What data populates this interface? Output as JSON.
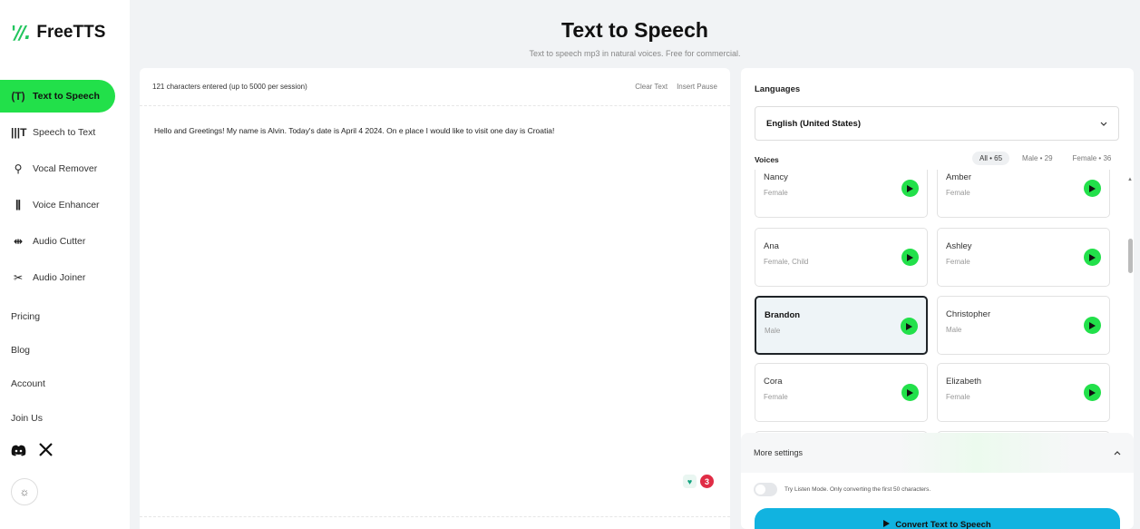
{
  "app": {
    "logo_mark": "'//.",
    "logo_text": "FreeTTS"
  },
  "sidebar": {
    "items": [
      {
        "label": "Text to Speech",
        "icon": "antenna-icon",
        "glyph": "(T)"
      },
      {
        "label": "Speech to Text",
        "icon": "waveform-text-icon",
        "glyph": "|||T"
      },
      {
        "label": "Vocal Remover",
        "icon": "microphone-icon",
        "glyph": "⚲"
      },
      {
        "label": "Voice Enhancer",
        "icon": "equalizer-icon",
        "glyph": "⫼"
      },
      {
        "label": "Audio Cutter",
        "icon": "cutter-icon",
        "glyph": "⇹"
      },
      {
        "label": "Audio Joiner",
        "icon": "scissors-icon",
        "glyph": "✂"
      }
    ],
    "links": [
      "Pricing",
      "Blog",
      "Account",
      "Join Us"
    ]
  },
  "header": {
    "title": "Text to Speech",
    "subtitle": "Text to speech mp3 in natural voices. Free for commercial."
  },
  "editor": {
    "char_count": "121 characters entered (up to 5000 per session)",
    "clear_label": "Clear Text",
    "pause_label": "Insert Pause",
    "text": "Hello and Greetings! My name is Alvin. Today's date is April 4 2024. On e place I would like to visit one day is Croatia!",
    "grammar_count": "3"
  },
  "panel": {
    "languages_label": "Languages",
    "language_value": "English (United States)",
    "voices_label": "Voices",
    "filters": [
      "All • 65",
      "Male • 29",
      "Female • 36"
    ],
    "active_filter": "All • 65",
    "voices": [
      {
        "name": "Nancy",
        "meta": "Female"
      },
      {
        "name": "Amber",
        "meta": "Female"
      },
      {
        "name": "Ana",
        "meta": "Female, Child"
      },
      {
        "name": "Ashley",
        "meta": "Female"
      },
      {
        "name": "Brandon",
        "meta": "Male"
      },
      {
        "name": "Christopher",
        "meta": "Male"
      },
      {
        "name": "Cora",
        "meta": "Female"
      },
      {
        "name": "Elizabeth",
        "meta": "Female"
      }
    ],
    "selected_voice": "Brandon",
    "more_settings_label": "More settings",
    "listen_mode_text": "Try Listen Mode. Only converting the first 50 characters.",
    "convert_label": "Convert Text to Speech"
  },
  "colors": {
    "accent_green": "#22e04a",
    "convert_blue": "#11b3e0",
    "grammar_red": "#e02c45",
    "background": "#f1f3f5"
  }
}
